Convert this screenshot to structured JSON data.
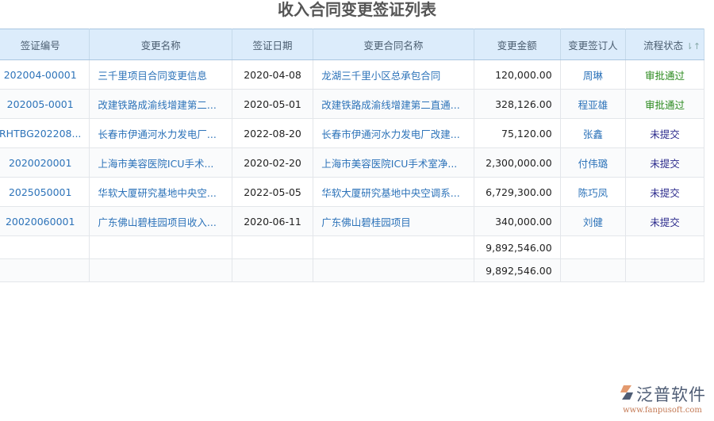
{
  "title": "收入合同变更签证列表",
  "columns": [
    "签证编号",
    "变更名称",
    "签证日期",
    "变更合同名称",
    "变更金额",
    "变更签订人",
    "流程状态"
  ],
  "sort_icon": "sort-icon",
  "rows": [
    {
      "no": "202004-00001",
      "name": "三千里项目合同变更信息",
      "date": "2020-04-08",
      "contract": "龙湖三千里小区总承包合同",
      "amount": "120,000.00",
      "signer": "周琳",
      "status": "审批通过",
      "ok": true
    },
    {
      "no": "202005-0001",
      "name": "改建铁路成渝线增建第二...",
      "date": "2020-05-01",
      "contract": "改建铁路成渝线增建第二直通...",
      "amount": "328,126.00",
      "signer": "程亚雄",
      "status": "审批通过",
      "ok": true
    },
    {
      "no": "RHTBG202208...",
      "name": "长春市伊通河水力发电厂...",
      "date": "2022-08-20",
      "contract": "长春市伊通河水力发电厂改建...",
      "amount": "75,120.00",
      "signer": "张鑫",
      "status": "未提交",
      "ok": false
    },
    {
      "no": "2020020001",
      "name": "上海市美容医院ICU手术...",
      "date": "2020-02-20",
      "contract": "上海市美容医院ICU手术室净...",
      "amount": "2,300,000.00",
      "signer": "付伟璐",
      "status": "未提交",
      "ok": false
    },
    {
      "no": "2025050001",
      "name": "华软大厦研究基地中央空...",
      "date": "2022-05-05",
      "contract": "华软大厦研究基地中央空调系...",
      "amount": "6,729,300.00",
      "signer": "陈巧凤",
      "status": "未提交",
      "ok": false
    },
    {
      "no": "20020060001",
      "name": "广东佛山碧桂园项目收入...",
      "date": "2020-06-11",
      "contract": "广东佛山碧桂园项目",
      "amount": "340,000.00",
      "signer": "刘健",
      "status": "未提交",
      "ok": false
    }
  ],
  "totals": [
    "9,892,546.00",
    "9,892,546.00"
  ],
  "logo": {
    "name": "泛普软件",
    "url": "www.fanpusoft.com"
  }
}
